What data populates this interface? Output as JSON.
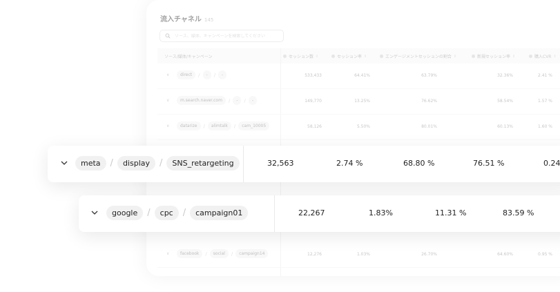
{
  "header": {
    "title": "流入チャネル",
    "count": "145"
  },
  "search": {
    "placeholder": "ソース、媒体、キャンペーンを検索してください"
  },
  "columns": {
    "source": "ソース/媒体/キャンペーン",
    "metrics": [
      "セッション数",
      "セッション率",
      "エンゲージメントセッションの割合",
      "新規セッション率",
      "購入CVR"
    ]
  },
  "rows": [
    {
      "source": [
        "direct",
        "-",
        "-"
      ],
      "values": [
        "533,433",
        "64.41%",
        "63.79%",
        "32.36%",
        "2.41 %"
      ]
    },
    {
      "source": [
        "m.search.naver.com",
        "-",
        "-"
      ],
      "values": [
        "149,770",
        "13.25%",
        "76.62%",
        "58.54%",
        "1.57 %"
      ]
    },
    {
      "source": [
        "datarize",
        "alimtalk",
        "cam_10005"
      ],
      "values": [
        "58,126",
        "5.50%",
        "80.01%",
        "60.13%",
        "1.60 %"
      ]
    },
    {
      "source": [
        "facebook",
        "social",
        "campaign14"
      ],
      "values": [
        "12,276",
        "1.03%",
        "26.70%",
        "64.60%",
        "0.95 %"
      ]
    }
  ],
  "highlight_rows": [
    {
      "source": [
        "meta",
        "display",
        "SNS_retargeting"
      ],
      "values": [
        "32,563",
        "2.74 %",
        "68.80 %",
        "76.51 %",
        "0.24"
      ]
    },
    {
      "source": [
        "google",
        "cpc",
        "campaign01"
      ],
      "values": [
        "22,267",
        "1.83%",
        "11.31 %",
        "83.59 %"
      ]
    }
  ],
  "icons": {
    "search": "search-icon",
    "expand": "chevron-down-icon",
    "sort": "sort-icon",
    "metric": "metric-dot-icon"
  }
}
